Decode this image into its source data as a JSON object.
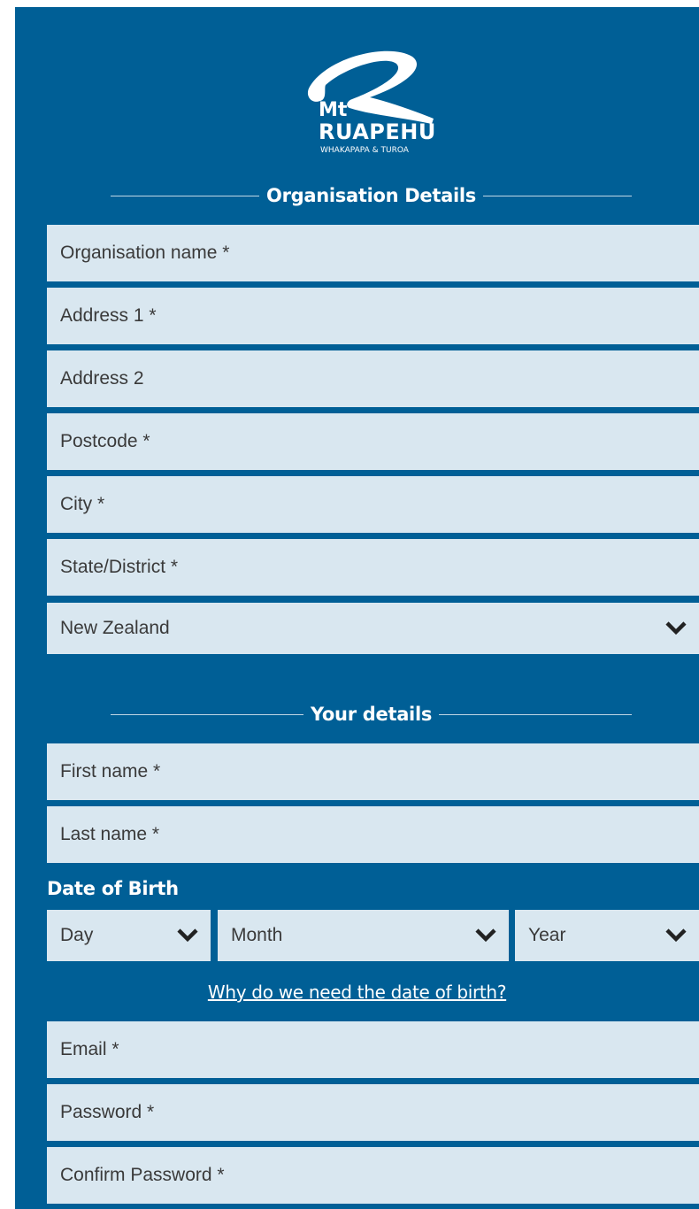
{
  "logo": {
    "line1": "Mt",
    "line2": "RUAPEHU",
    "line3": "WHAKAPAPA & TUROA"
  },
  "organisation_section": {
    "title": "Organisation Details",
    "fields": {
      "org_name": "Organisation name *",
      "address1": "Address 1 *",
      "address2": "Address 2",
      "postcode": "Postcode *",
      "city": "City *",
      "state": "State/District *"
    },
    "country": "New Zealand"
  },
  "details_section": {
    "title": "Your details",
    "fields": {
      "first_name": "First name *",
      "last_name": "Last name *",
      "email": "Email *",
      "password": "Password *",
      "confirm_password": "Confirm Password *"
    },
    "dob": {
      "label": "Date of Birth",
      "day": "Day",
      "month": "Month",
      "year": "Year",
      "help_link": "Why do we need the date of birth?"
    }
  },
  "colors": {
    "panel_bg": "#005f96",
    "field_bg": "#d9e7f0",
    "field_text": "#3a3a3a",
    "chevron": "#222222"
  },
  "icons": {
    "select_arrow": "chevron-down-icon"
  }
}
